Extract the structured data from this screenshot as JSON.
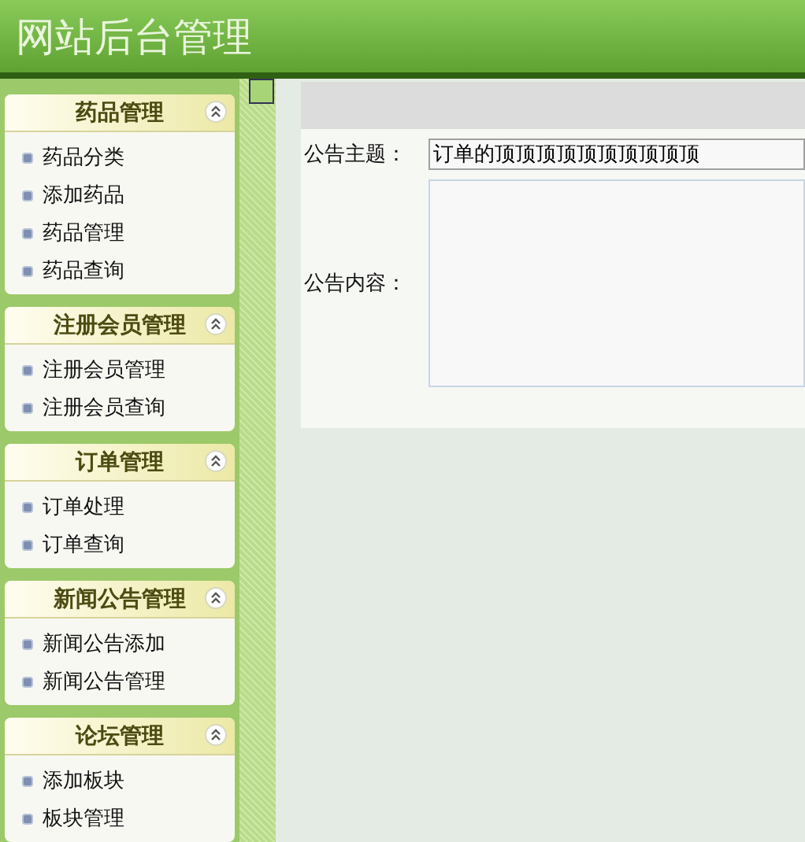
{
  "header": {
    "title": "网站后台管理"
  },
  "sidebar": {
    "sections": [
      {
        "title": "药品管理",
        "expanded": true,
        "items": [
          "药品分类",
          "添加药品",
          "药品管理",
          "药品查询"
        ]
      },
      {
        "title": "注册会员管理",
        "expanded": true,
        "items": [
          "注册会员管理",
          "注册会员查询"
        ]
      },
      {
        "title": "订单管理",
        "expanded": true,
        "items": [
          "订单处理",
          "订单查询"
        ]
      },
      {
        "title": "新闻公告管理",
        "expanded": true,
        "items": [
          "新闻公告添加",
          "新闻公告管理"
        ]
      },
      {
        "title": "论坛管理",
        "expanded": true,
        "items": [
          "添加板块",
          "板块管理"
        ]
      }
    ]
  },
  "form": {
    "fields": [
      {
        "kind": "text",
        "label": "公告主题：",
        "value": "订单的顶顶顶顶顶顶顶顶顶顶"
      },
      {
        "kind": "textarea",
        "label": "公告内容："
      }
    ]
  }
}
